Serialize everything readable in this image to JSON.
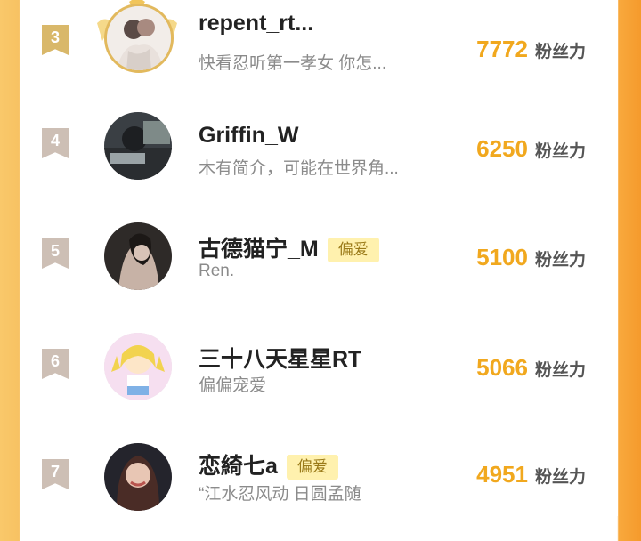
{
  "unit_label": "粉丝力",
  "colors": {
    "accent": "#f1a81e",
    "badge_bg": "#fff1ae"
  },
  "rows": [
    {
      "rank": "3",
      "name": "repent_rt...",
      "badge": "",
      "desc": "快看忍听第一孝女 你怎...",
      "score": "7772"
    },
    {
      "rank": "4",
      "name": "Griffin_W",
      "badge": "",
      "desc": "木有简介，可能在世界角...",
      "score": "6250"
    },
    {
      "rank": "5",
      "name": "古德猫宁_M",
      "badge": "偏爱",
      "desc": "Ren.",
      "score": "5100"
    },
    {
      "rank": "6",
      "name": "三十八天星星RT",
      "badge": "",
      "desc": "偏偏宠爱",
      "score": "5066"
    },
    {
      "rank": "7",
      "name": "恋綺七a",
      "badge": "偏爱",
      "desc": "“江水忍风动 日圆孟随",
      "score": "4951"
    }
  ]
}
